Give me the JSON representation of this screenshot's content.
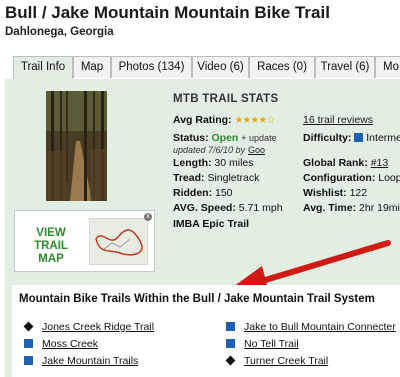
{
  "page": {
    "title": "Bull / Jake Mountain Mountain Bike Trail",
    "location": "Dahlonega, Georgia"
  },
  "tabs": [
    {
      "label": "Trail Info",
      "active": true
    },
    {
      "label": "Map",
      "active": false
    },
    {
      "label": "Photos (134)",
      "active": false
    },
    {
      "label": "Video (6)",
      "active": false
    },
    {
      "label": "Races (0)",
      "active": false
    },
    {
      "label": "Travel (6)",
      "active": false
    },
    {
      "label": "Mo",
      "active": false
    }
  ],
  "map_box": {
    "label_line1": "VIEW",
    "label_line2": "TRAIL MAP",
    "close": "x"
  },
  "stats": {
    "title": "MTB TRAIL STATS",
    "avg_rating_label": "Avg Rating:",
    "rating_stars": 4,
    "reviews_link": "16 trail reviews",
    "status_label": "Status:",
    "status_value": "Open",
    "status_update": "+ update",
    "updated_text": "updated 7/6/10 by",
    "updated_by": "Goo",
    "difficulty_label": "Difficulty:",
    "difficulty_value": "Intermed",
    "length_label": "Length:",
    "length_value": "30 miles",
    "global_rank_label": "Global Rank:",
    "global_rank_value": "#13",
    "tread_label": "Tread:",
    "tread_value": "Singletrack",
    "configuration_label": "Configuration:",
    "configuration_value": "Loop",
    "ridden_label": "Ridden:",
    "ridden_value": "150",
    "wishlist_label": "Wishlist:",
    "wishlist_value": "122",
    "avg_speed_label": "AVG. Speed:",
    "avg_speed_value": "5.71 mph",
    "avg_time_label": "Avg. Time:",
    "avg_time_value": "2hr 19min",
    "epic": "IMBA Epic Trail"
  },
  "system": {
    "heading": "Mountain Bike Trails Within the Bull / Jake Mountain Trail System",
    "items": [
      {
        "name": "Jones Creek Ridge Trail",
        "marker": "diamond"
      },
      {
        "name": "Jake to Bull Mountain Connecter",
        "marker": "square"
      },
      {
        "name": "Moss Creek",
        "marker": "square"
      },
      {
        "name": "No Tell Trail",
        "marker": "square"
      },
      {
        "name": "Jake Mountain Trails",
        "marker": "square"
      },
      {
        "name": "Turner Creek Trail",
        "marker": "diamond"
      }
    ]
  },
  "colors": {
    "accent_green": "#2e8b2e",
    "panel_bg": "#e3eee3",
    "square_blue": "#1f5fb4",
    "arrow_red": "#d01a14",
    "star_gold": "#e8a81a"
  }
}
